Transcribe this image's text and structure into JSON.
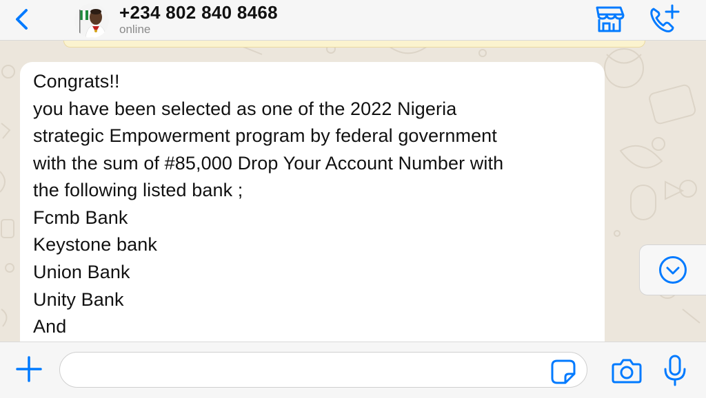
{
  "header": {
    "contact_name": "+234 802 840 8468",
    "status": "online",
    "icons": [
      "back-chevron-icon",
      "storefront-icon",
      "add-call-icon"
    ]
  },
  "message": {
    "lines": [
      "Congrats!!",
      "you have been selected as one of the 2022 Nigeria",
      "strategic Empowerment program by federal government",
      "with the sum of #85,000 Drop Your Account Number with",
      "the following listed bank ;",
      "Fcmb Bank",
      "Keystone bank",
      "Union Bank",
      "Unity Bank",
      "And"
    ]
  },
  "composer": {
    "input_value": "",
    "icons": [
      "plus-icon",
      "sticker-icon",
      "camera-icon",
      "microphone-icon"
    ]
  },
  "colors": {
    "accent": "#007aff",
    "bubble": "#ffffff",
    "wallpaper": "#ece6dc"
  }
}
